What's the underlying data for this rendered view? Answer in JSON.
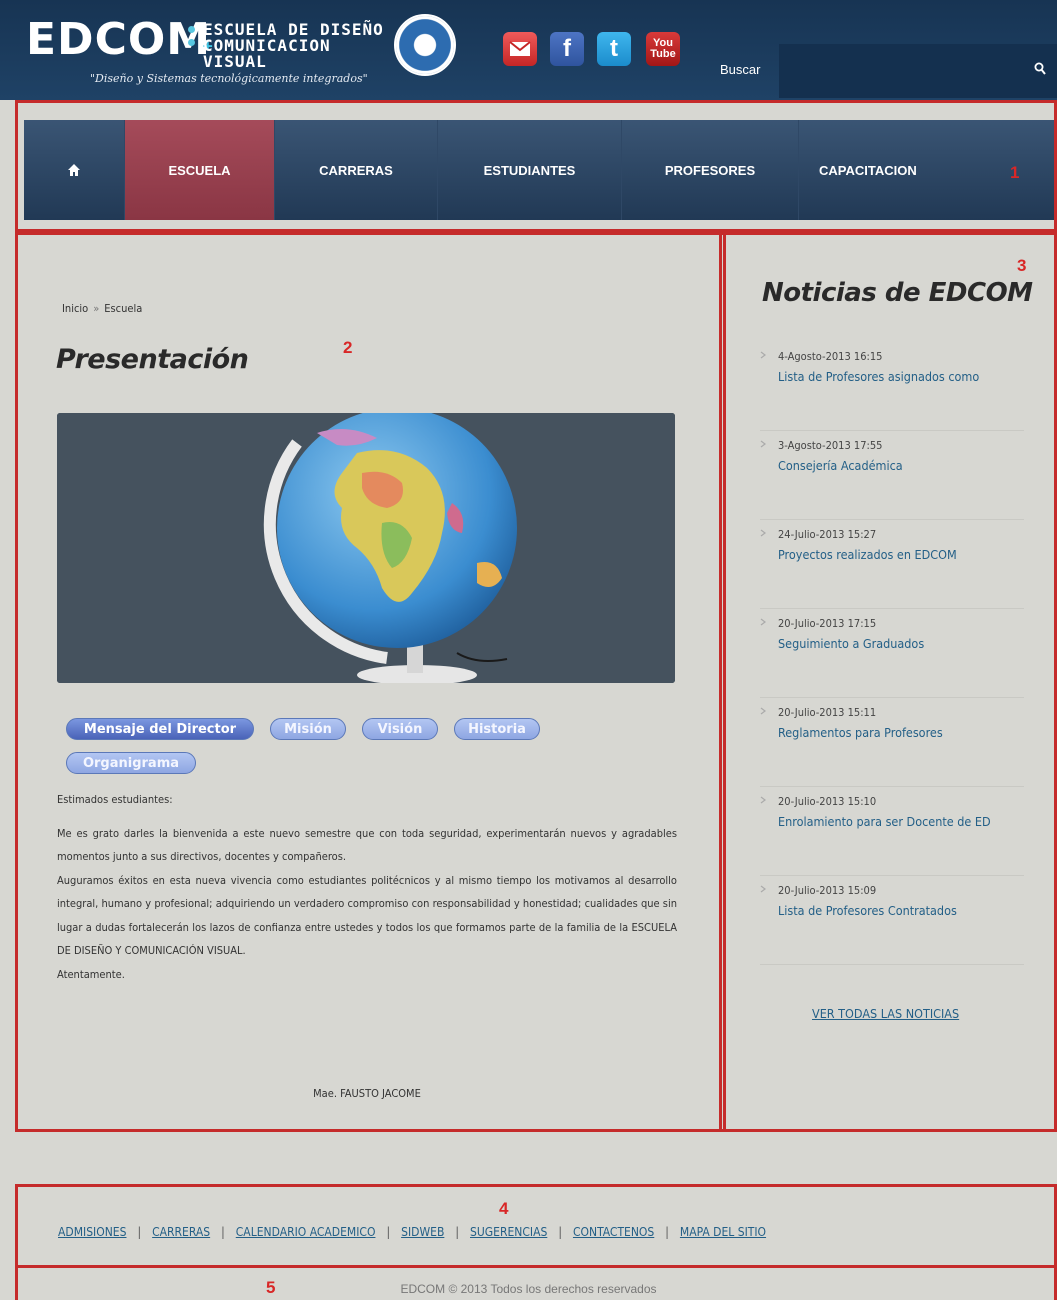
{
  "header": {
    "logo_word": "EDCOM",
    "logo_line1": "ESCUELA DE DISEÑO",
    "logo_plus": "+",
    "logo_line2": "COMUNICACION VISUAL",
    "tagline": "\"Diseño y Sistemas tecnológicamente integrados\"",
    "social": {
      "mail_icon": "mail-icon",
      "facebook_label": "f",
      "twitter_label": "t",
      "youtube_label_1": "You",
      "youtube_label_2": "Tube"
    },
    "search_label": "Buscar",
    "search_value": ""
  },
  "nav": {
    "items": [
      {
        "label": "ESCUELA",
        "active": true
      },
      {
        "label": "CARRERAS"
      },
      {
        "label": "ESTUDIANTES"
      },
      {
        "label": "PROFESORES"
      },
      {
        "label": "CAPACITACION"
      }
    ]
  },
  "annotations": [
    "1",
    "2",
    "3",
    "4",
    "5"
  ],
  "main": {
    "breadcrumb": {
      "home": "Inicio",
      "sep": "»",
      "current": "Escuela"
    },
    "title": "Presentación",
    "tabs": [
      {
        "label": "Mensaje del Director",
        "active": true
      },
      {
        "label": "Misión"
      },
      {
        "label": "Visión"
      },
      {
        "label": "Historia"
      },
      {
        "label": "Organigrama"
      }
    ],
    "greeting": "Estimados estudiantes:",
    "paragraph1": "Me es grato darles la bienvenida a este nuevo semestre que con toda seguridad, experimentarán nuevos y agradables momentos junto a sus directivos, docentes y compañeros.",
    "paragraph2": "Auguramos éxitos en esta nueva vivencia como estudiantes politécnicos y al mismo tiempo los motivamos al desarrollo integral, humano y profesional; adquiriendo un verdadero compromiso con responsabilidad y honestidad; cualidades que sin lugar a dudas fortalecerán los lazos de confianza entre ustedes y todos los que formamos parte de la familia de la ESCUELA DE DISEÑO Y COMUNICACIÓN VISUAL.",
    "closing": "Atentamente.",
    "signature": "Mae. FAUSTO JACOME"
  },
  "sidebar": {
    "title": "Noticias de EDCOM",
    "news": [
      {
        "date": "4-Agosto-2013 16:15",
        "title": "Lista de Profesores asignados como"
      },
      {
        "date": "3-Agosto-2013 17:55",
        "title": "Consejería Académica"
      },
      {
        "date": "24-Julio-2013 15:27",
        "title": "Proyectos realizados en EDCOM"
      },
      {
        "date": "20-Julio-2013 17:15",
        "title": "Seguimiento a Graduados"
      },
      {
        "date": "20-Julio-2013 15:11",
        "title": "Reglamentos para Profesores"
      },
      {
        "date": "20-Julio-2013 15:10",
        "title": "Enrolamiento para ser Docente de ED"
      },
      {
        "date": "20-Julio-2013 15:09",
        "title": "Lista de Profesores Contratados"
      }
    ],
    "see_all": "VER TODAS LAS NOTICIAS"
  },
  "footer": {
    "links": [
      "ADMISIONES",
      "CARRERAS",
      "CALENDARIO ACADEMICO",
      "SIDWEB",
      "SUGERENCIAS",
      "CONTACTENOS",
      "MAPA DEL SITIO"
    ],
    "separator": "|",
    "copyright": "EDCOM © 2013 Todos los derechos reservados"
  },
  "colors": {
    "header_bg": "#1f4266",
    "nav_active": "#9b4452",
    "link": "#235f87",
    "annotation": "#c52b2b",
    "page_bg": "#d7d7d2"
  }
}
